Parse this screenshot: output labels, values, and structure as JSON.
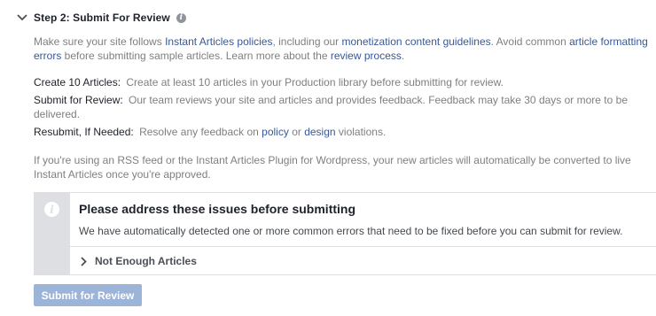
{
  "step": {
    "title": "Step 2: Submit For Review"
  },
  "intro": {
    "t1": "Make sure your site follows ",
    "link1": "Instant Articles policies",
    "t2": ", including our ",
    "link2": "monetization content guidelines",
    "t3": ". Avoid common ",
    "link3": "article formatting errors",
    "t4": " before submitting sample articles. Learn more about the ",
    "link4": "review process",
    "t5": "."
  },
  "steps": [
    {
      "term": "Create 10 Articles:",
      "text": "Create at least 10 articles in your Production library before submitting for review."
    },
    {
      "term": "Submit for Review:",
      "text": "Our team reviews your site and articles and provides feedback. Feedback may take 30 days or more to be delivered."
    },
    {
      "term": "Resubmit, If Needed:",
      "t1": "Resolve any feedback on ",
      "link1": "policy",
      "t2": " or ",
      "link2": "design",
      "t3": " violations."
    }
  ],
  "rss_note": "If you're using an RSS feed or the Instant Articles Plugin for Wordpress, your new articles will automatically be converted to live Instant Articles once you're approved.",
  "issues": {
    "title": "Please address these issues before submitting",
    "description": "We have automatically detected one or more common errors that need to be fixed before you can submit for review.",
    "items": [
      {
        "label": "Not Enough Articles"
      }
    ]
  },
  "submit_button": {
    "label": "Submit for Review",
    "disabled": true
  },
  "colors": {
    "link": "#365899",
    "muted_text": "#7f7f7f",
    "disabled_button": "#9cb4d8",
    "panel_gray": "#dddfe2"
  }
}
